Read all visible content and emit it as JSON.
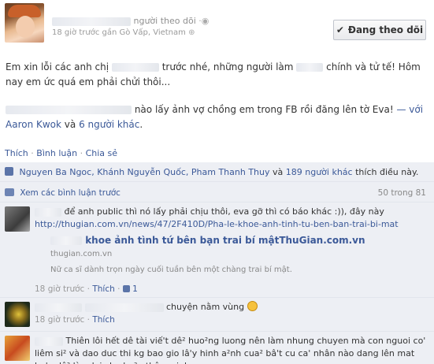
{
  "post": {
    "name_suffix": "người theo dõi",
    "meta": "18 giờ trước gần Gò Vấp, Vietnam",
    "follow_button": "Đang theo dõi",
    "text1_a": "Em xin lỗi các anh chị",
    "text1_b": "trước nhé, những người làm",
    "text1_c": "chính và tử tế! Hôm nay em ức quá em phải chửi thôi...",
    "text2_a": "nào lấy ảnh vợ chồng em trong FB rồi đăng lên tờ Eva!",
    "text2_with": "— với",
    "text2_tag1": "Aaron Kwok",
    "text2_and": "và",
    "text2_tag2": "6 người khác",
    "text2_end": "."
  },
  "actions": {
    "like": "Thích",
    "comment": "Bình luận",
    "share": "Chia sẻ"
  },
  "likes": {
    "names": "Nguyen Ba Ngoc, Khánh Nguyễn Quốc, Pham Thanh Thuy",
    "and": "và",
    "others": "189 người khác",
    "suffix": "thích điều này."
  },
  "view_previous": {
    "label": "Xem các bình luận trước",
    "count": "50 trong 81"
  },
  "comments": [
    {
      "text": "để anh public thì nó lấy phải chịu thôi, eva gỡ thì có báo khác :)), đây này",
      "url": "http://thugian.com.vn/news/47/2F410D/Pha-le-khoe-anh-tinh-tu-ben-ban-trai-bi-mat",
      "card_title": "khoe ảnh tình tứ bên bạn trai bí mật",
      "card_title_site": "ThuGian.com.vn",
      "card_domain": "thugian.com.vn",
      "card_desc": "Nữ ca sĩ dành trọn ngày cuối tuần bên một chàng trai bí mật.",
      "time": "18 giờ trước",
      "like": "Thích",
      "like_count": "1"
    },
    {
      "text": "chuyện nằm vùng",
      "time": "18 giờ trước",
      "like": "Thích"
    },
    {
      "text": "Thiên lôi hết dê tài viế't dê² huo²ng luong nên làm nhung chuyen mà con nguoi co' liêm si² và dao duc thi kg bao gio lâ'y hinh a²nh cua² bâ't cu ca' nhân nào dang lên mat ba'o dê² làm loi cho ba²n thân minh"
    }
  ],
  "colors": {
    "link": "#3b5998",
    "ufi_bg": "#edeff4"
  }
}
